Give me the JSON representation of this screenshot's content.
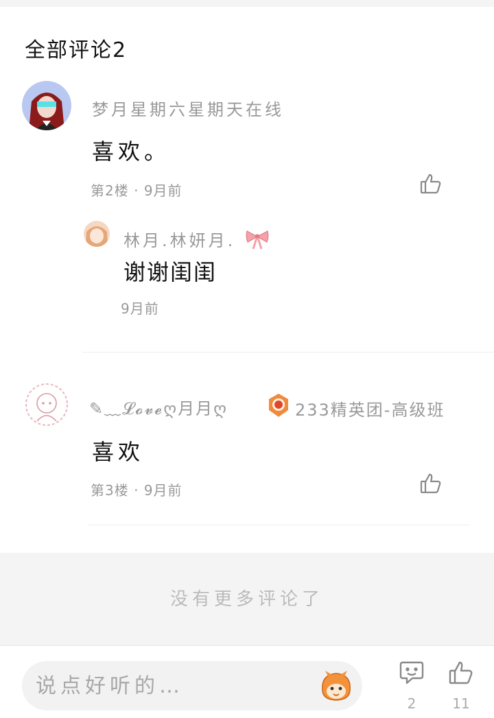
{
  "header": {
    "title": "全部评论2"
  },
  "comments": [
    {
      "username": "梦月星期六星期天在线",
      "text": "喜欢。",
      "floor": "第2楼",
      "time": "9月前",
      "reply": {
        "username": "林月.林妍月.",
        "text": "谢谢闺闺",
        "time": "9月前"
      }
    },
    {
      "username": "✎﹏𝓛𝓸𝓿𝓮ღ月月ღ",
      "badge_text": "233精英团-高级班",
      "text": "喜欢",
      "floor": "第3楼",
      "time": "9月前"
    }
  ],
  "footer_note": "没有更多评论了",
  "bottom_bar": {
    "input_placeholder": "说点好听的…",
    "comment_count": "2",
    "like_count": "11"
  },
  "icons": {
    "like": "thumbs-up-icon",
    "comment": "chat-bubble-icon",
    "bow": "pink-bow-icon",
    "badge": "orange-medal-icon",
    "mascot": "mascot-face-icon"
  },
  "colors": {
    "muted_text": "#999999",
    "bow_pink": "#f4a1a8",
    "badge_orange": "#f08a3c"
  }
}
